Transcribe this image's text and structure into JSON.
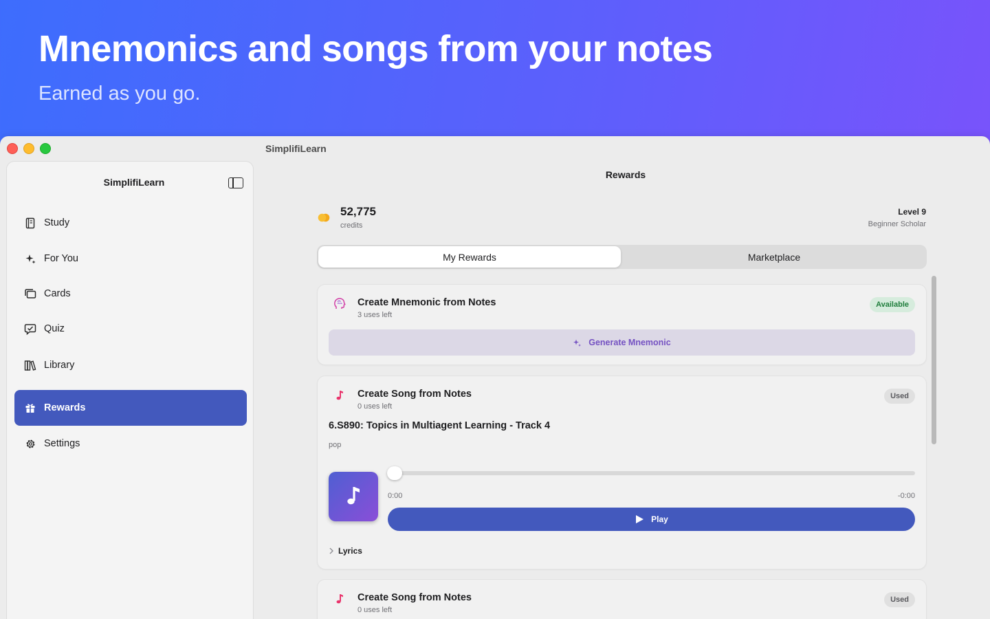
{
  "hero": {
    "title": "Mnemonics and songs from your notes",
    "subtitle": "Earned as you go."
  },
  "window": {
    "title": "SimplifiLearn"
  },
  "sidebar": {
    "title": "SimplifiLearn",
    "items": [
      {
        "label": "Study",
        "icon": "book-icon"
      },
      {
        "label": "For You",
        "icon": "sparkles-icon"
      },
      {
        "label": "Cards",
        "icon": "cards-icon"
      },
      {
        "label": "Quiz",
        "icon": "quiz-bubble-icon"
      },
      {
        "label": "Library",
        "icon": "library-icon"
      },
      {
        "label": "Rewards",
        "icon": "gift-icon",
        "active": true
      },
      {
        "label": "Settings",
        "icon": "gear-icon"
      }
    ]
  },
  "main": {
    "title": "Rewards",
    "credits": {
      "value": "52,775",
      "label": "credits"
    },
    "level": {
      "title": "Level 9",
      "subtitle": "Beginner Scholar"
    },
    "tabs": [
      {
        "label": "My Rewards",
        "selected": true
      },
      {
        "label": "Marketplace",
        "selected": false
      }
    ],
    "rewards": [
      {
        "title": "Create Mnemonic from Notes",
        "uses": "3 uses left",
        "status": "Available",
        "action": "Generate Mnemonic"
      },
      {
        "title": "Create Song from Notes",
        "uses": "0 uses left",
        "status": "Used",
        "track_title": "6.S890: Topics in Multiagent Learning - Track 4",
        "genre": "pop",
        "time_elapsed": "0:00",
        "time_remaining": "-0:00",
        "progress": 0,
        "play_label": "Play",
        "lyrics_label": "Lyrics"
      },
      {
        "title": "Create Song from Notes",
        "uses": "0 uses left",
        "status": "Used"
      }
    ]
  },
  "colors": {
    "accent": "#4359bd",
    "available_text": "#1e7d3b",
    "mnemonic_purple": "#7552c2",
    "song_pink": "#e9336b",
    "coin_yellow": "#f8be32"
  }
}
